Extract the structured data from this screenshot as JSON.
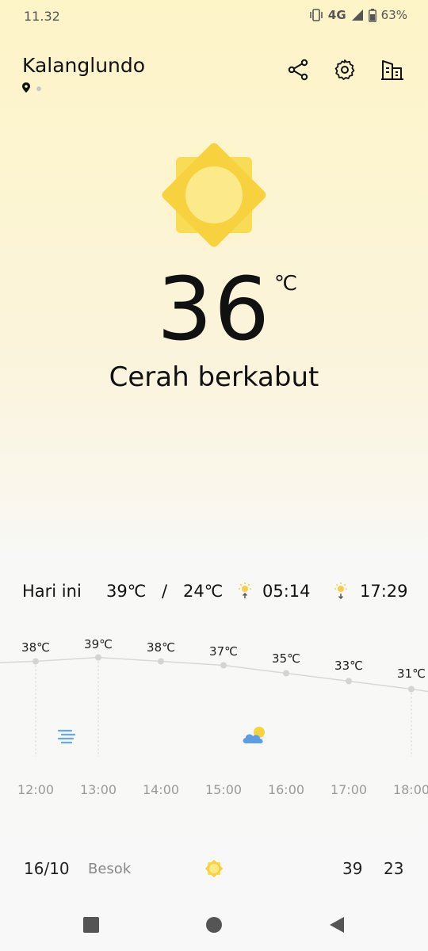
{
  "status_bar": {
    "time": "11.32",
    "network": "4G",
    "battery": "63%"
  },
  "header": {
    "city": "Kalanglundo",
    "icons": [
      "share-icon",
      "settings-icon",
      "buildings-icon"
    ]
  },
  "current": {
    "temperature": "36",
    "unit": "℃",
    "condition": "Cerah berkabut",
    "icon": "sunny-icon"
  },
  "today": {
    "label": "Hari ini",
    "high": "39℃",
    "separator": "/",
    "low": "24℃",
    "sunrise": "05:14",
    "sunset": "17:29"
  },
  "hourly": [
    {
      "time": "12:00",
      "temp": "38℃",
      "icon": "haze-icon"
    },
    {
      "time": "13:00",
      "temp": "39℃",
      "icon": ""
    },
    {
      "time": "14:00",
      "temp": "38℃",
      "icon": ""
    },
    {
      "time": "15:00",
      "temp": "37℃",
      "icon": "partly-cloudy-icon"
    },
    {
      "time": "16:00",
      "temp": "35℃",
      "icon": ""
    },
    {
      "time": "17:00",
      "temp": "33℃",
      "icon": ""
    },
    {
      "time": "18:00",
      "temp": "31℃",
      "icon": ""
    }
  ],
  "daily": [
    {
      "date": "16/10",
      "label": "Besok",
      "icon": "sunny-icon",
      "high": "39",
      "low": "23"
    }
  ],
  "colors": {
    "sun": "#f9d84a",
    "sun_core": "#fce98a",
    "accent_blue": "#6aa8e8"
  }
}
